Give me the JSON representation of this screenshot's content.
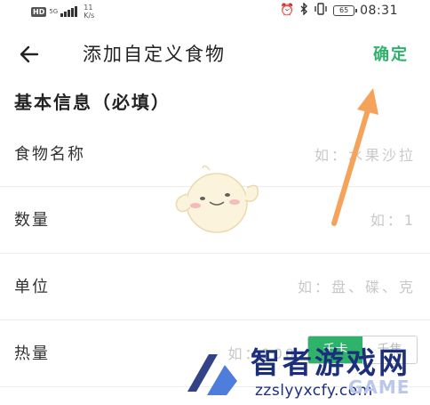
{
  "status_bar": {
    "hd_badge": "HD",
    "network_type": "5G",
    "net_speed_value": "11",
    "net_speed_unit": "K/s",
    "battery_level": "65",
    "time": "08:31"
  },
  "app_bar": {
    "title": "添加自定义食物",
    "confirm_label": "确定",
    "back_icon": "arrow-left-icon"
  },
  "section": {
    "title": "基本信息（必填）"
  },
  "form": {
    "food_name": {
      "label": "食物名称",
      "placeholder": "如：水果沙拉"
    },
    "quantity": {
      "label": "数量",
      "placeholder": "如：1"
    },
    "unit": {
      "label": "单位",
      "placeholder": "如：盘、碟、克"
    },
    "calories": {
      "label": "热量",
      "placeholder": "如：100",
      "unit_options": [
        "千卡",
        "千焦"
      ],
      "selected_unit": "千卡"
    }
  },
  "watermark": {
    "title": "智者游戏网",
    "url": "zzslyyxcfy.com",
    "game_text": "GAME"
  },
  "colors": {
    "accent": "#2fb36b",
    "annotation_arrow": "#f5a25a",
    "watermark_blue": "#1c2f7a"
  }
}
